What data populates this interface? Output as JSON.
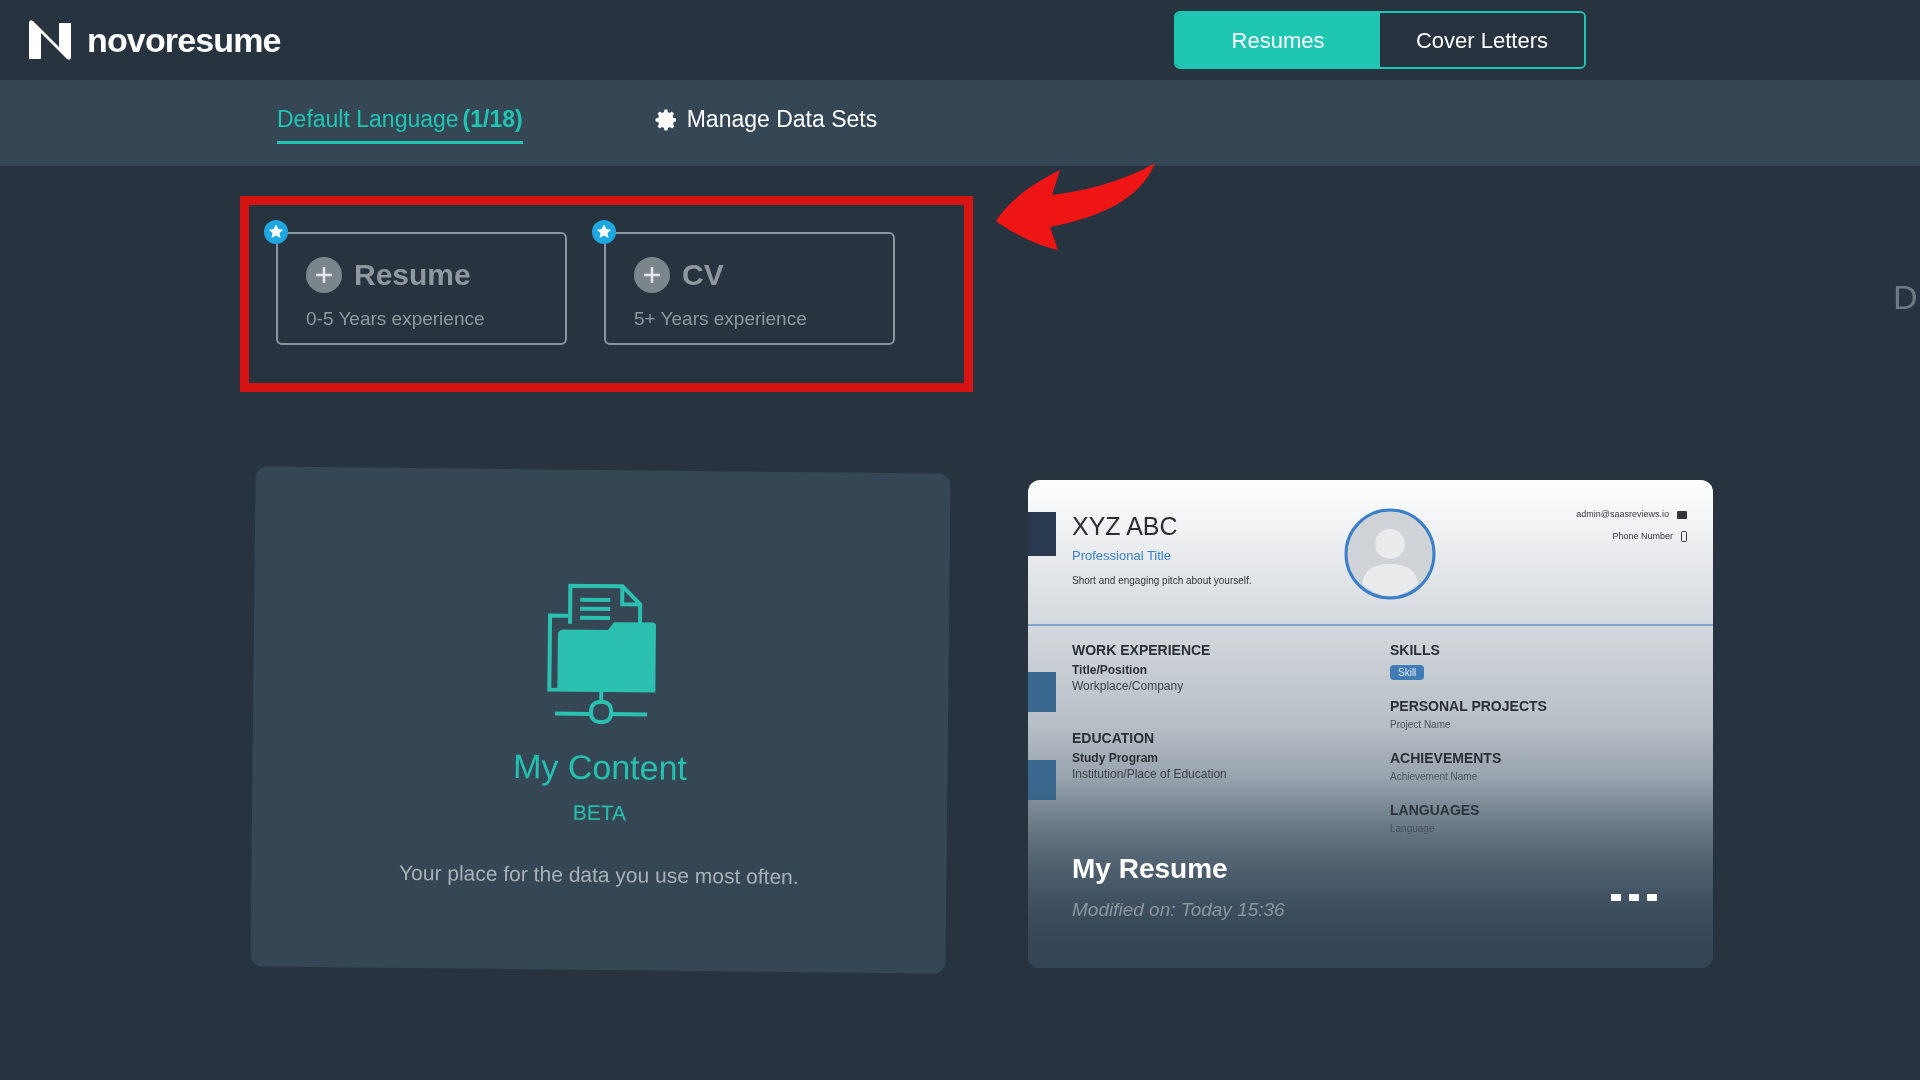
{
  "header": {
    "logo": "novoresume",
    "tabs": [
      {
        "label": "Resumes",
        "selected": true
      },
      {
        "label": "Cover Letters",
        "selected": false
      }
    ]
  },
  "subnav": {
    "items": [
      {
        "kind": "language",
        "label": "Default Language",
        "count": "(1/18)",
        "selected": true
      },
      {
        "kind": "manage",
        "label": "Manage Data Sets",
        "selected": false
      }
    ]
  },
  "new_document": [
    {
      "title": "Resume",
      "subtitle": "0-5 Years experience",
      "starred": true
    },
    {
      "title": "CV",
      "subtitle": "5+ Years experience",
      "starred": true
    }
  ],
  "my_content": {
    "title": "My Content",
    "badge": "BETA",
    "description": "Your place for the data you use most often."
  },
  "resume_card": {
    "preview": {
      "name": "XYZ ABC",
      "professional_title": "Professional Title",
      "pitch": "Short and engaging pitch about yourself.",
      "email": "admin@saasreviews.io",
      "phone": "Phone Number",
      "columns": [
        [
          {
            "title": "WORK EXPERIENCE",
            "items": [
              {
                "kind": "bold",
                "text": "Title/Position"
              },
              {
                "kind": "plain",
                "text": "Workplace/Company"
              }
            ]
          },
          {
            "title": "EDUCATION",
            "items": [
              {
                "kind": "bold",
                "text": "Study Program"
              },
              {
                "kind": "plain",
                "text": "Institution/Place of Education"
              }
            ]
          }
        ],
        [
          {
            "title": "SKILLS",
            "items": [
              {
                "kind": "tag",
                "text": "Skill"
              }
            ]
          },
          {
            "title": "PERSONAL PROJECTS",
            "items": [
              {
                "kind": "small",
                "text": "Project Name"
              }
            ]
          },
          {
            "title": "ACHIEVEMENTS",
            "items": [
              {
                "kind": "small",
                "text": "Achievement Name"
              }
            ]
          },
          {
            "title": "LANGUAGES",
            "items": [
              {
                "kind": "small",
                "text": "Language"
              }
            ]
          }
        ]
      ]
    },
    "title": "My Resume",
    "modified": "Modified on: Today 15:36"
  },
  "edge_text": "D"
}
